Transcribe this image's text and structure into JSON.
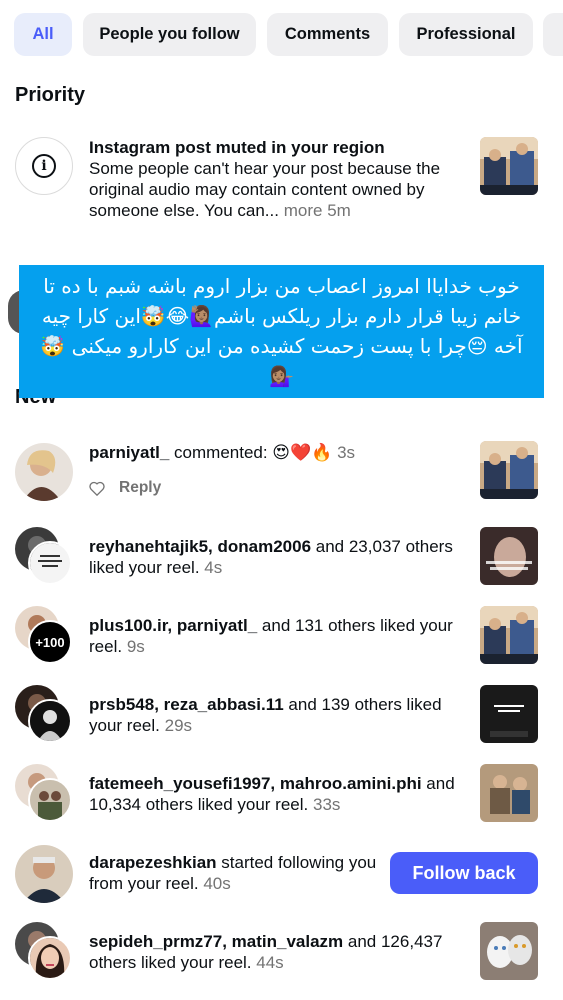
{
  "filters": [
    "All",
    "People you follow",
    "Comments",
    "Professional"
  ],
  "sections": {
    "priority": "Priority",
    "new": "New"
  },
  "priority": {
    "title": "Instagram post muted in your region",
    "body": "Some people can't hear your post because the original audio may contain content owned by someone else. You can...",
    "more": "more",
    "time": "5m"
  },
  "overlay_text": "خوب خدایاا امروز اعصاب من بزار اروم باشه شبم با ده تا خانم زیبا قرار دارم بزار ریلکس باشم🙋🏽‍♀️😂🤯این کارا چیه آخه 😔چرا با پست زحمت کشیده من این کارارو میکنی 🤯💁🏽‍♀️",
  "notifications": [
    {
      "users": "parniyatl_",
      "text": " commented: 😍❤️🔥",
      "time": "3s",
      "reply": "Reply"
    },
    {
      "users": "reyhanehtajik5, donam2006",
      "text": " and 23,037 others liked your reel.",
      "time": "4s"
    },
    {
      "users": "plus100.ir, parniyatl_",
      "text": " and 131 others liked your reel.",
      "time": "9s",
      "badge": "+100"
    },
    {
      "users": "prsb548, reza_abbasi.11",
      "text": " and 139 others liked your reel.",
      "time": "29s"
    },
    {
      "users": "fatemeeh_yousefi1997, mahroo.amini.phi",
      "text": " and 10,334 others liked your reel.",
      "time": "33s"
    },
    {
      "users": "darapezeshkian",
      "text": " started following you from your reel.",
      "time": "40s",
      "button": "Follow back"
    },
    {
      "users": "sepideh_prmz77, matin_valazm",
      "text": " and 126,437 others liked your reel.",
      "time": "44s"
    }
  ],
  "colors": {
    "accent": "#4a5df9",
    "banner": "#05a0ee",
    "chip_active_bg": "#e8edfb",
    "muted": "#737373"
  }
}
